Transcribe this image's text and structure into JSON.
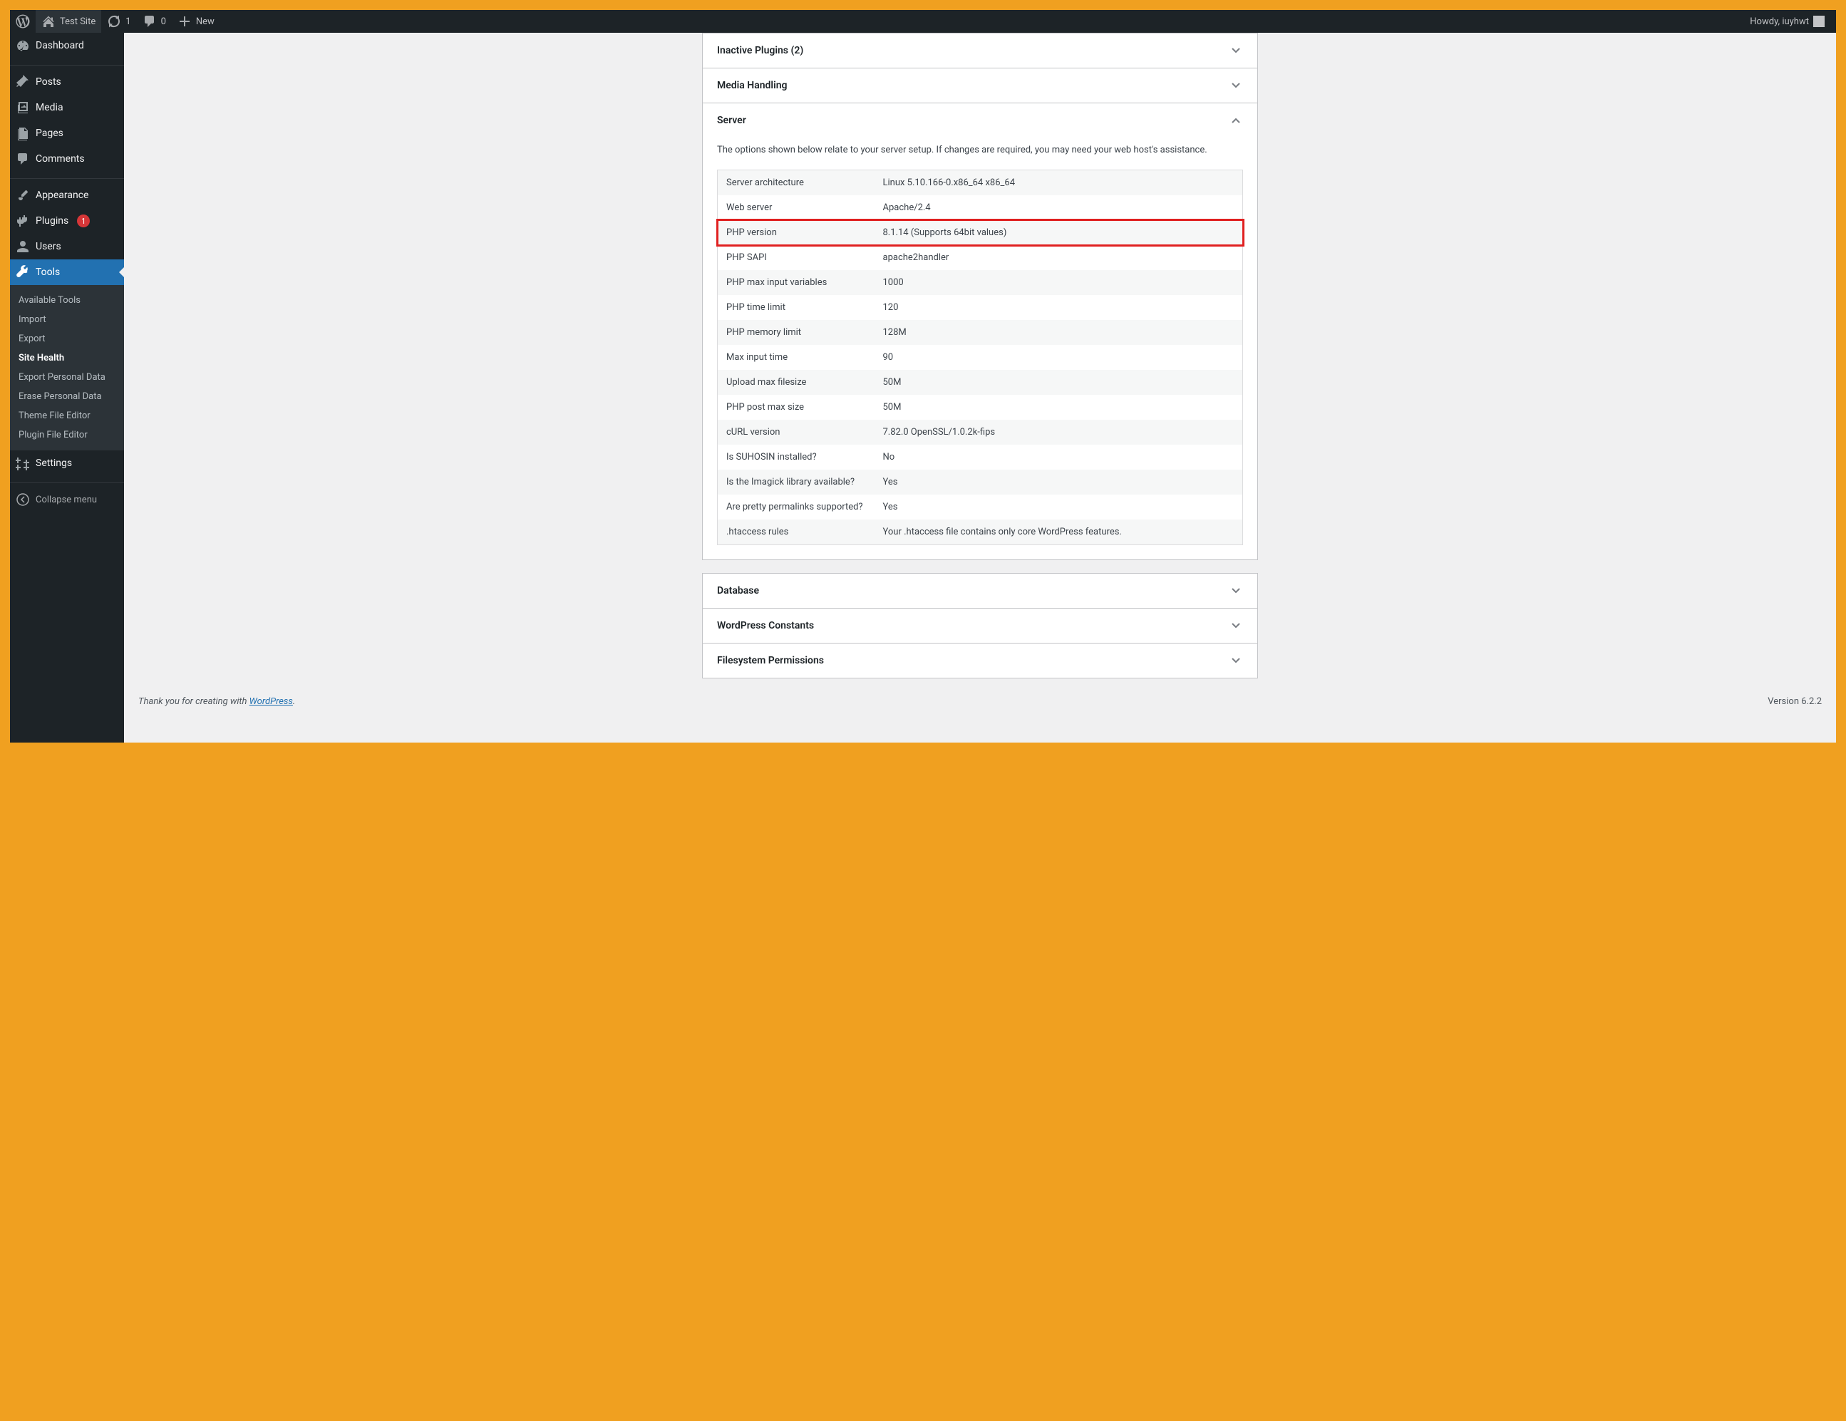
{
  "adminbar": {
    "site_name": "Test Site",
    "updates_count": "1",
    "comments_count": "0",
    "new_label": "New",
    "howdy": "Howdy, iuyhwt"
  },
  "menu": {
    "dashboard": "Dashboard",
    "posts": "Posts",
    "media": "Media",
    "pages": "Pages",
    "comments": "Comments",
    "appearance": "Appearance",
    "plugins": "Plugins",
    "plugins_badge": "1",
    "users": "Users",
    "tools": "Tools",
    "settings": "Settings",
    "collapse": "Collapse menu"
  },
  "submenu": {
    "available_tools": "Available Tools",
    "import": "Import",
    "export": "Export",
    "site_health": "Site Health",
    "export_personal": "Export Personal Data",
    "erase_personal": "Erase Personal Data",
    "theme_editor": "Theme File Editor",
    "plugin_editor": "Plugin File Editor"
  },
  "panels": {
    "inactive_plugins": "Inactive Plugins (2)",
    "media_handling": "Media Handling",
    "server": "Server",
    "server_desc": "The options shown below relate to your server setup. If changes are required, you may need your web host's assistance.",
    "database": "Database",
    "wp_constants": "WordPress Constants",
    "fs_permissions": "Filesystem Permissions"
  },
  "server_table": [
    {
      "label": "Server architecture",
      "value": "Linux 5.10.166-0.x86_64 x86_64"
    },
    {
      "label": "Web server",
      "value": "Apache/2.4"
    },
    {
      "label": "PHP version",
      "value": "8.1.14 (Supports 64bit values)",
      "highlight": true
    },
    {
      "label": "PHP SAPI",
      "value": "apache2handler"
    },
    {
      "label": "PHP max input variables",
      "value": "1000"
    },
    {
      "label": "PHP time limit",
      "value": "120"
    },
    {
      "label": "PHP memory limit",
      "value": "128M"
    },
    {
      "label": "Max input time",
      "value": "90"
    },
    {
      "label": "Upload max filesize",
      "value": "50M"
    },
    {
      "label": "PHP post max size",
      "value": "50M"
    },
    {
      "label": "cURL version",
      "value": "7.82.0 OpenSSL/1.0.2k-fips"
    },
    {
      "label": "Is SUHOSIN installed?",
      "value": "No"
    },
    {
      "label": "Is the Imagick library available?",
      "value": "Yes"
    },
    {
      "label": "Are pretty permalinks supported?",
      "value": "Yes"
    },
    {
      "label": ".htaccess rules",
      "value": "Your .htaccess file contains only core WordPress features."
    }
  ],
  "footer": {
    "thanks_prefix": "Thank you for creating with ",
    "thanks_link": "WordPress",
    "thanks_suffix": ".",
    "version": "Version 6.2.2"
  }
}
